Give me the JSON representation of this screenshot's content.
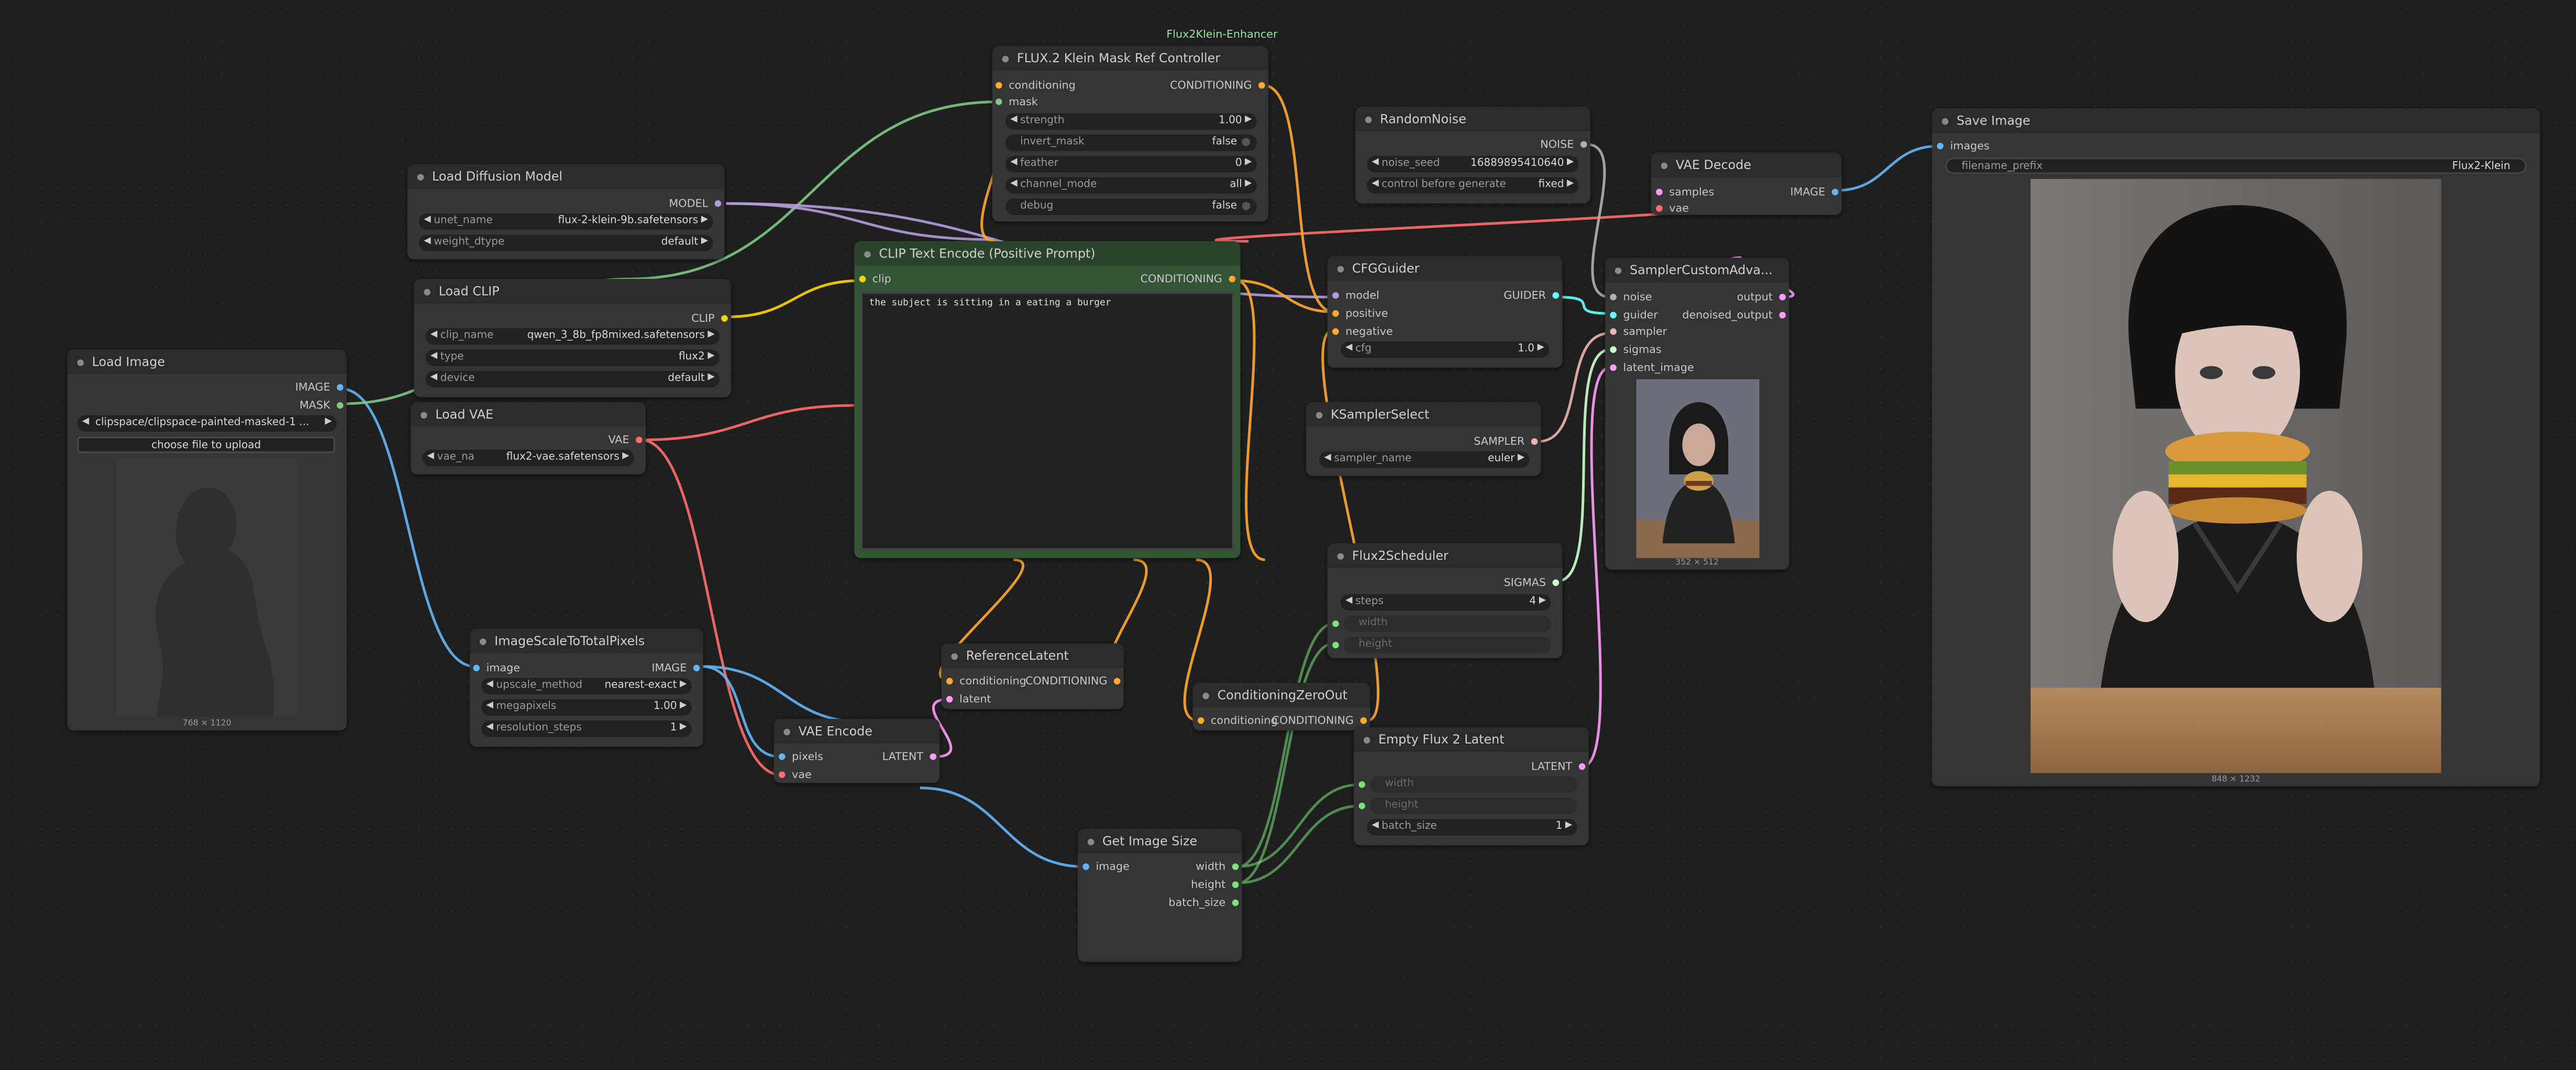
{
  "colors": {
    "canvas": "#1f1f1f",
    "node": "#353535",
    "node_title": "#2b2b2b",
    "image": "#64b5f6",
    "mask": "#81c784",
    "model": "#b39ddb",
    "clip": "#ffd500",
    "vae": "#ff6e6e",
    "conditioning": "#ffa931",
    "latent": "#ff9cf9",
    "int": "#7ce27c",
    "noise": "#b0b0b0",
    "guider": "#66ffff",
    "sampler": "#ecb4b4",
    "sigmas": "#cdffcd",
    "group_label": "#9be29b",
    "positive_node": "#335533"
  },
  "group": {
    "title": "Flux2Klein-Enhancer"
  },
  "load_image": {
    "title": "Load Image",
    "out_image": "IMAGE",
    "out_mask": "MASK",
    "image_value": "clipspace/clipspace-painted-masked-1 ...",
    "upload_button": "choose file to upload",
    "preview_size": "768 × 1120",
    "preview_icon": "person-silhouette-icon"
  },
  "load_diffusion": {
    "title": "Load Diffusion Model",
    "out_model": "MODEL",
    "unet_label": "unet_name",
    "unet_value": "flux-2-klein-9b.safetensors",
    "dtype_label": "weight_dtype",
    "dtype_value": "default"
  },
  "load_clip": {
    "title": "Load CLIP",
    "out_clip": "CLIP",
    "clip_label": "clip_name",
    "clip_value": "qwen_3_8b_fp8mixed.safetensors",
    "type_label": "type",
    "type_value": "flux2",
    "device_label": "device",
    "device_value": "default"
  },
  "load_vae": {
    "title": "Load VAE",
    "out_vae": "VAE",
    "vae_label": "vae_na",
    "vae_value": "flux2-vae.safetensors"
  },
  "mask_ref": {
    "title": "FLUX.2 Klein Mask Ref Controller",
    "in_cond": "conditioning",
    "in_mask": "mask",
    "out_cond": "CONDITIONING",
    "strength_label": "strength",
    "strength_value": "1.00",
    "invert_label": "invert_mask",
    "invert_value": "false",
    "feather_label": "feather",
    "feather_value": "0",
    "channel_label": "channel_mode",
    "channel_value": "all",
    "debug_label": "debug",
    "debug_value": "false"
  },
  "clip_encode": {
    "title": "CLIP Text Encode (Positive Prompt)",
    "in_clip": "clip",
    "out_cond": "CONDITIONING",
    "prompt": "the subject is sitting in a eating a burger"
  },
  "random_noise": {
    "title": "RandomNoise",
    "out_noise": "NOISE",
    "seed_label": "noise_seed",
    "seed_value": "168898954106​40",
    "control_label": "control before generate",
    "control_value": "fixed"
  },
  "cfg_guider": {
    "title": "CFGGuider",
    "in_model": "model",
    "in_positive": "positive",
    "in_negative": "negative",
    "out_guider": "GUIDER",
    "cfg_label": "cfg",
    "cfg_value": "1.0"
  },
  "ksampler_select": {
    "title": "KSamplerSelect",
    "out_sampler": "SAMPLER",
    "sampler_label": "sampler_name",
    "sampler_value": "euler"
  },
  "flux2_scheduler": {
    "title": "Flux2Scheduler",
    "out_sigmas": "SIGMAS",
    "steps_label": "steps",
    "steps_value": "4",
    "width_label": "width",
    "height_label": "height"
  },
  "vae_decode": {
    "title": "VAE Decode",
    "in_samples": "samples",
    "in_vae": "vae",
    "out_image": "IMAGE"
  },
  "sampler_custom": {
    "title": "SamplerCustomAdva...",
    "in_noise": "noise",
    "in_guider": "guider",
    "in_sampler": "sampler",
    "in_sigmas": "sigmas",
    "in_latent": "latent_image",
    "out_output": "output",
    "out_denoised": "denoised_output",
    "preview_size": "352 × 512"
  },
  "save_image": {
    "title": "Save Image",
    "in_images": "images",
    "prefix_label": "filename_prefix",
    "prefix_value": "Flux2-Klein",
    "preview_size": "848 × 1232"
  },
  "image_scale": {
    "title": "ImageScaleToTotalPixels",
    "in_image": "image",
    "out_image": "IMAGE",
    "method_label": "upscale_method",
    "method_value": "nearest-exact",
    "mp_label": "megapixels",
    "mp_value": "1.00",
    "steps_label": "resolution_steps",
    "steps_value": "1"
  },
  "vae_encode": {
    "title": "VAE Encode",
    "in_pixels": "pixels",
    "in_vae": "vae",
    "out_latent": "LATENT"
  },
  "reference_latent": {
    "title": "ReferenceLatent",
    "in_cond": "conditioning",
    "in_latent": "latent",
    "out_cond": "CONDITIONING"
  },
  "cond_zero": {
    "title": "ConditioningZeroOut",
    "in_cond": "conditioning",
    "out_cond": "CONDITIONING"
  },
  "empty_latent": {
    "title": "Empty Flux 2 Latent",
    "out_latent": "LATENT",
    "width_label": "width",
    "height_label": "height",
    "batch_label": "batch_size",
    "batch_value": "1"
  },
  "get_image_size": {
    "title": "Get Image Size",
    "in_image": "image",
    "out_width": "width",
    "out_height": "height",
    "out_batch": "batch_size"
  }
}
